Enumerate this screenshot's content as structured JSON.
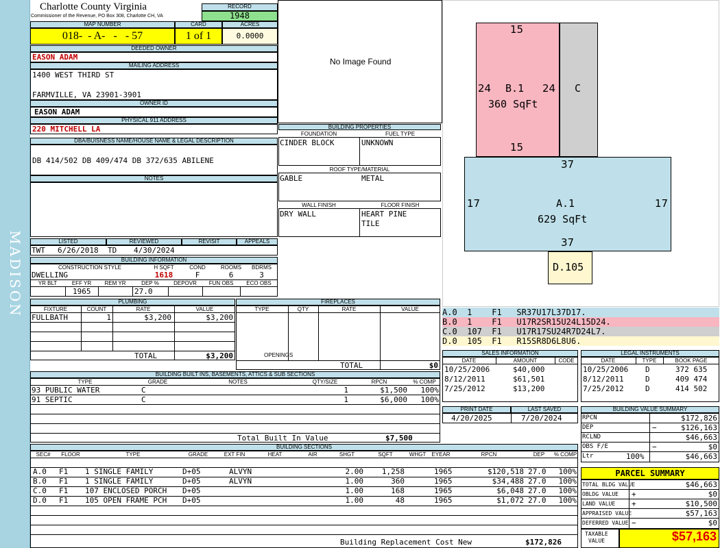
{
  "side_label": "MADISON",
  "county": {
    "name": "Charlotte County Virginia",
    "address": "Commissioner of the Revenue, PO Box 308, Charlotte CH, VA"
  },
  "record": {
    "label": "RECORD",
    "value": "1948"
  },
  "map": {
    "label": "MAP NUMBER",
    "value": "018-  - A-   -   - 57",
    "card_label": "CARD",
    "card": "1 of 1",
    "acres_label": "ACRES",
    "acres": "0.0000"
  },
  "owner": {
    "label": "DEEDED OWNER",
    "value": "EASON ADAM"
  },
  "mailing": {
    "label": "MAILING ADDRESS",
    "line1": "1400 WEST THIRD ST",
    "line2": "FARMVILLE, VA 23901-3901"
  },
  "owner_id": {
    "label": "OWNER ID",
    "value": "EASON ADAM"
  },
  "physical": {
    "label": "PHYSICAL 911 ADDRESS",
    "value": "220 MITCHELL LA"
  },
  "legal": {
    "label": "DBA/BUISNESS NAME/HOUSE NAME & LEGAL DESCRIPTION",
    "value": "DB 414/502 DB 409/474 DB 372/635  ABILENE"
  },
  "notes": {
    "label": "NOTES"
  },
  "image": {
    "text": "No Image Found"
  },
  "listed": {
    "listed_label": "LISTED",
    "reviewed_label": "REVIEWED",
    "revisit_label": "REVISIT",
    "appeals_label": "APPEALS",
    "listed_by": "TWT",
    "listed_date": "6/26/2018",
    "reviewed_by": "TD",
    "reviewed_date": "4/30/2024"
  },
  "building_info": {
    "label": "BUILDING INFORMATION",
    "style_label": "CONSTRUCTION STYLE",
    "hsqft_label": "H SQFT",
    "cond_label": "COND",
    "rooms_label": "ROOMS",
    "bdrms_label": "BDRMS",
    "style": "DWELLING",
    "hsqft": "1618",
    "cond": "F",
    "rooms": "6",
    "bdrms": "3",
    "yrblt_label": "YR BLT",
    "effyr_label": "EFF YR",
    "remyr_label": "REM YR",
    "dep_label": "DEP %",
    "depovr_label": "DEPOVR",
    "funobs_label": "FUN OBS",
    "ecoobs_label": "ECO OBS",
    "effyr": "1965",
    "dep": "27.0"
  },
  "building_props": {
    "label": "BUILDING PROPERTIES",
    "foundation_label": "FOUNDATION",
    "fuel_label": "FUEL TYPE",
    "foundation": "CINDER BLOCK",
    "fuel": "UNKNOWN",
    "roof_label": "ROOF TYPE/MATERIAL",
    "roof_type": "GABLE",
    "roof_material": "METAL",
    "wall_label": "WALL FINISH",
    "floor_label": "FLOOR FINISH",
    "wall": "DRY WALL",
    "floor1": "HEART PINE",
    "floor2": "TILE"
  },
  "plumbing": {
    "label": "PLUMBING",
    "headers": [
      "FIXTURE",
      "COUNT",
      "RATE",
      "VALUE"
    ],
    "rows": [
      [
        "FULLBATH",
        "1",
        "$3,200",
        "$3,200"
      ]
    ],
    "total_label": "TOTAL",
    "total": "$3,200"
  },
  "fireplaces": {
    "label": "FIREPLACES",
    "headers": [
      "TYPE",
      "QTY",
      "RATE",
      "VALUE"
    ],
    "openings_label": "OPENINGS",
    "total_label": "TOTAL",
    "total": "$0"
  },
  "builtins": {
    "label": "BUILDING BUILT INS, BASEMENTS, ATTICS & SUB SECTIONS",
    "headers": [
      "TYPE",
      "GRADE",
      "NOTES",
      "QTY/SIZE",
      "RPCN",
      "% COMP"
    ],
    "rows": [
      [
        "93 PUBLIC WATER",
        "C",
        "",
        "1",
        "$1,500",
        "100%"
      ],
      [
        "91 SEPTIC",
        "C",
        "",
        "1",
        "$6,000",
        "100%"
      ]
    ],
    "total_label": "Total Built In Value",
    "total": "$7,500"
  },
  "sections": {
    "label": "BUILDING SECTIONS",
    "headers": [
      "SEC#",
      "FLOOR",
      "TYPE",
      "GRADE",
      "EXT FIN",
      "HEAT",
      "AIR",
      "SHGT",
      "SQFT",
      "WHGT",
      "EYEAR",
      "RPCN",
      "DEP",
      "% COMP"
    ],
    "rows": [
      [
        "A.0",
        "F1",
        "1 SINGLE FAMILY",
        "D+05",
        "ALVYN",
        "",
        "",
        "2.00",
        "1,258",
        "",
        "1965",
        "$120,518",
        "27.0",
        "100%"
      ],
      [
        "B.0",
        "F1",
        "1 SINGLE FAMILY",
        "D+05",
        "ALVYN",
        "",
        "",
        "1.00",
        "360",
        "",
        "1965",
        "$34,488",
        "27.0",
        "100%"
      ],
      [
        "C.0",
        "F1",
        "107 ENCLOSED PORCH",
        "D+05",
        "",
        "",
        "",
        "1.00",
        "168",
        "",
        "1965",
        "$6,048",
        "27.0",
        "100%"
      ],
      [
        "D.0",
        "F1",
        "105 OPEN FRAME PCH",
        "D+05",
        "",
        "",
        "",
        "1.00",
        "48",
        "",
        "1965",
        "$1,072",
        "27.0",
        "100%"
      ]
    ],
    "replacement_label": "Building Replacement Cost New",
    "replacement": "$172,826"
  },
  "sketch": {
    "b_label": "B.1",
    "b_area": "360 SqFt",
    "b_top": "15",
    "b_bottom": "15",
    "b_left": "24",
    "b_right": "24",
    "c_label": "C",
    "a_label": "A.1",
    "a_area": "629 SqFt",
    "a_top": "37",
    "a_bottom": "37",
    "a_left": "17",
    "a_right": "17",
    "d_label": "D.105"
  },
  "vectors": [
    {
      "text": "A.0  1    F1   SR37U17L37D17.",
      "color": "#bfe0ea"
    },
    {
      "text": "B.0  1    F1   U17R2SR15U24L15D24.",
      "color": "#f7b6c0"
    },
    {
      "text": "C.0  107  F1   U17R17SU24R7D24L7.",
      "color": "#cfcfcf"
    },
    {
      "text": "D.0  105  F1   R15SR8D6L8U6.",
      "color": "#fff7d0"
    }
  ],
  "sales": {
    "label": "SALES INFORMATION",
    "headers": [
      "DATE",
      "AMOUNT",
      "CODE"
    ],
    "rows": [
      [
        "10/25/2006",
        "$40,000",
        ""
      ],
      [
        "8/12/2011",
        "$61,501",
        ""
      ],
      [
        "7/25/2012",
        "$13,200",
        ""
      ]
    ]
  },
  "instruments": {
    "label": "LEGAL INSTRUMENTS",
    "headers": [
      "DATE",
      "TYPE",
      "BOOK PAGE"
    ],
    "rows": [
      [
        "10/25/2006",
        "D",
        "372 635"
      ],
      [
        "8/12/2011",
        "D",
        "409 474"
      ],
      [
        "7/25/2012",
        "D",
        "414 502"
      ]
    ]
  },
  "print": {
    "print_label": "PRINT DATE",
    "saved_label": "LAST SAVED",
    "print_date": "4/20/2025",
    "saved_date": "7/20/2024"
  },
  "value_summary": {
    "label": "BUILDING VALUE SUMMARY",
    "rows": [
      [
        "RPCN",
        "",
        "",
        "$172,826"
      ],
      [
        "DEP",
        "",
        "−",
        "$126,163"
      ],
      [
        "RCLND",
        "",
        "",
        "$46,663"
      ],
      [
        "OBS F/E",
        "",
        "−",
        "$0"
      ],
      [
        "Ltr",
        "100%",
        "",
        "$46,663"
      ]
    ]
  },
  "parcel": {
    "label": "PARCEL SUMMARY",
    "rows": [
      [
        "TOTAL BLDG VALUE",
        "",
        "$46,663"
      ],
      [
        "OBLDG VALUE",
        "+",
        "$0"
      ],
      [
        "LAND VALUE",
        "+",
        "$10,500"
      ],
      [
        "APPRAISED VALUE",
        "",
        "$57,163"
      ],
      [
        "DEFERRED VALUE",
        "−",
        "$0"
      ]
    ],
    "taxable_label1": "TAXABLE",
    "taxable_label2": "VALUE",
    "taxable": "$57,163"
  }
}
